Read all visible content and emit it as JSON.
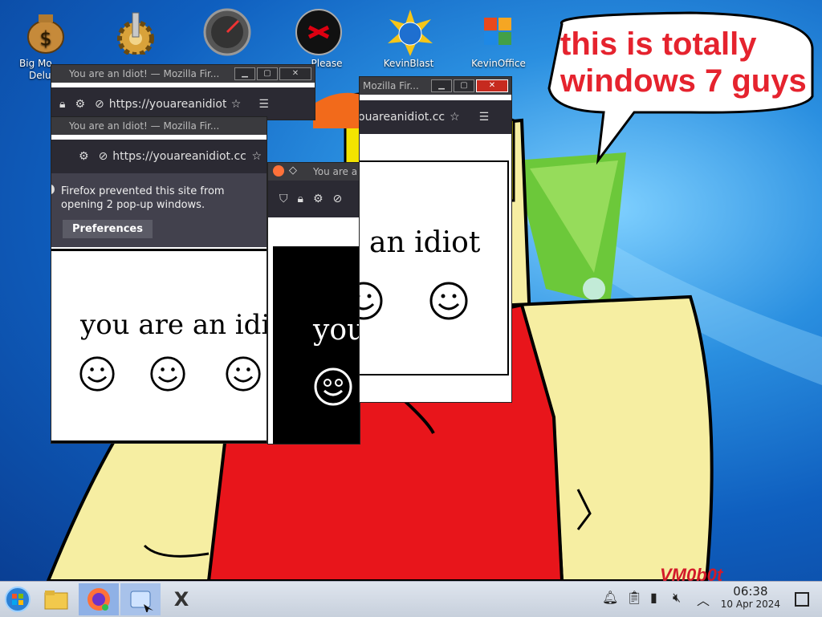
{
  "desktop": {
    "speech_bubble": {
      "line1": "this is totally",
      "line2": "windows 7 guys"
    },
    "signature": "VM0b0t",
    "icons": [
      {
        "icon": "money-bag-icon",
        "label": "Big Mo",
        "label2": "Delu"
      },
      {
        "icon": "gear-icon",
        "label": ""
      },
      {
        "icon": "speedometer-icon",
        "label": ""
      },
      {
        "icon": "virus-icon",
        "label": "Please"
      },
      {
        "icon": "kevinblast-icon",
        "label": "KevinBlast"
      },
      {
        "icon": "kevinoffice-icon",
        "label": "KevinOffice"
      }
    ]
  },
  "windows": {
    "win1": {
      "title": "You are an Idiot! — Mozilla Fir...",
      "url": "https://youareanidiot",
      "headline": "you are an idiot"
    },
    "win2": {
      "title": "You are an Idiot! — Mozilla Fir...",
      "url": "https://youareanidiot.cc",
      "notification": "Firefox prevented this site from opening 2 pop-up windows.",
      "notif_line1": "Firefox prevented this site from",
      "notif_line2": "opening 2 pop-up windows.",
      "preferences_label": "Preferences",
      "headline": "you are an idiot"
    },
    "win3": {
      "title": "Mozilla Fir...",
      "url": "ouareanidiot.cc",
      "headline": "an idiot"
    },
    "win4": {
      "title": "You are a",
      "headline": "you"
    }
  },
  "taskbar": {
    "start": "start-orb-icon",
    "apps": [
      "folder-icon",
      "firefox-icon",
      "app-icon",
      "x-app-icon"
    ],
    "tray_icons": [
      "notification-bell-icon",
      "clipboard-icon",
      "battery-icon",
      "volume-muted-icon",
      "chevron-up-icon"
    ],
    "clock_time": "06:38",
    "clock_date": "10 Apr 2024"
  },
  "colors": {
    "accent_red": "#e5232e",
    "desktop_blue": "#1e6fd0",
    "firefox_dark": "#2b2a33"
  }
}
